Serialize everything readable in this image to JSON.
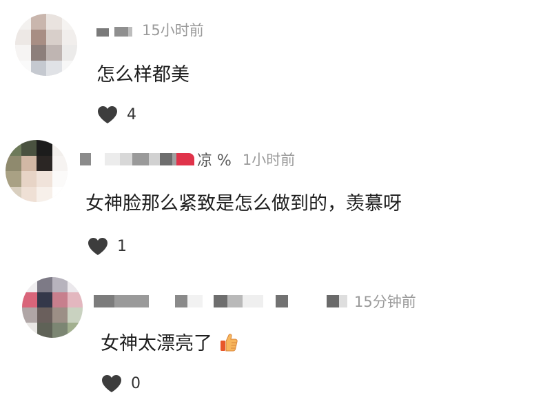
{
  "comments": [
    {
      "username_suffix": "",
      "time": "15小时前",
      "text": "怎么样都美",
      "likes": "4",
      "emoji": ""
    },
    {
      "username_suffix": "凉 %",
      "time": "1小时前",
      "text": "女神脸那么紧致是怎么做到的，羡慕呀",
      "likes": "1",
      "emoji": ""
    },
    {
      "username_suffix": "",
      "time": "15分钟前",
      "text": "女神太漂亮了",
      "likes": "0",
      "emoji": "thumbs-up-icon"
    }
  ],
  "colors": {
    "heart": "#3d3d3d",
    "time": "#9a9a9a",
    "accent_red": "#e0334a"
  }
}
